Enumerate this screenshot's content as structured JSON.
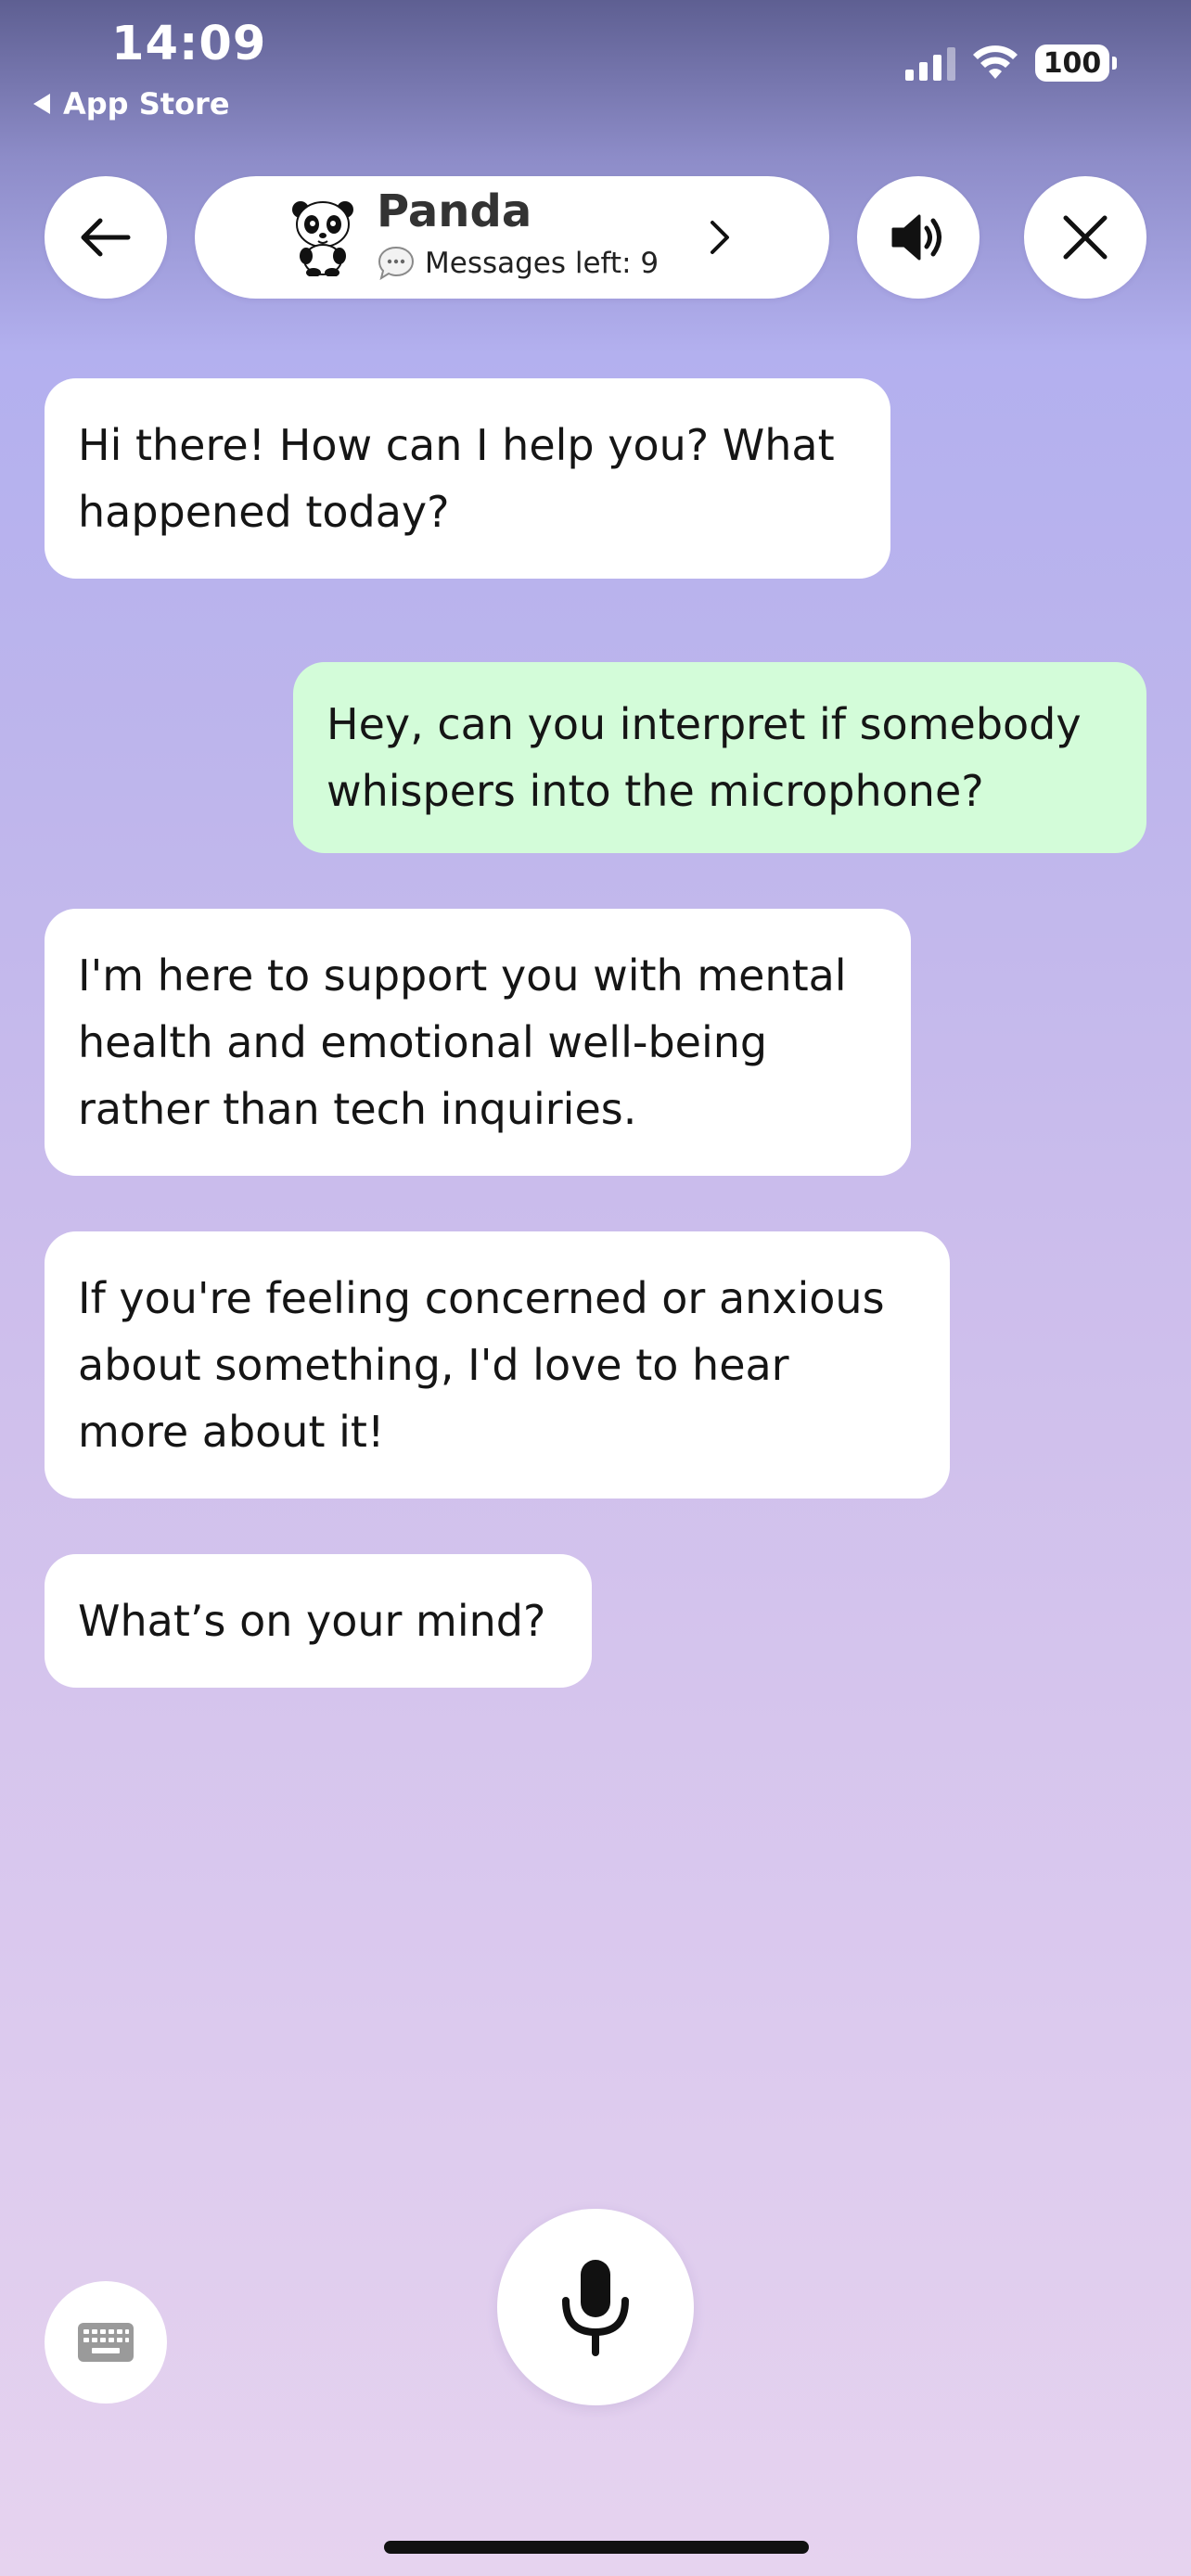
{
  "status_bar": {
    "time": "14:09",
    "back_label": "App Store",
    "battery": "100"
  },
  "header": {
    "name": "Panda",
    "messages_left": "Messages left: 9"
  },
  "messages": [
    {
      "sender": "bot",
      "lines": [
        "Hi there! How can I help you? What",
        "happened today?"
      ]
    },
    {
      "sender": "user",
      "lines": [
        "Hey, can you interpret if somebody",
        "whispers into the microphone?"
      ]
    },
    {
      "sender": "bot",
      "lines": [
        "I'm here to support you with mental",
        "health and emotional well-being",
        "rather than tech inquiries."
      ]
    },
    {
      "sender": "bot",
      "lines": [
        "If you're feeling concerned or anxious",
        "about something, I'd love to hear",
        "more about it!"
      ]
    },
    {
      "sender": "bot",
      "lines": [
        "What’s on your mind?"
      ]
    }
  ],
  "icons": {
    "back": "arrow-left-icon",
    "sound": "speaker-icon",
    "close": "close-icon",
    "chevron": "chevron-right-icon",
    "keyboard": "keyboard-icon",
    "mic": "microphone-icon",
    "chat": "speech-bubble-icon"
  },
  "colors": {
    "user_bubble": "#d3fcd9",
    "bot_bubble": "#ffffff"
  }
}
